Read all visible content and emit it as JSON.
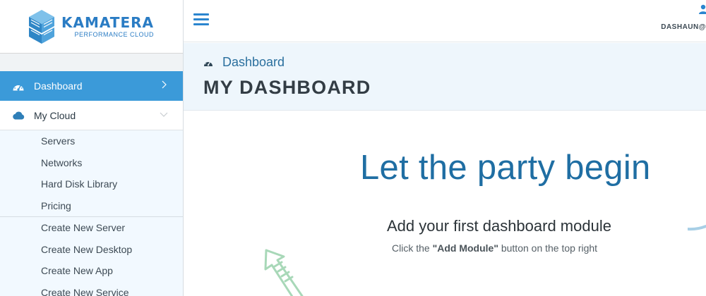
{
  "brand": {
    "name": "KAMATERA",
    "tagline": "PERFORMANCE CLOUD",
    "primary_color": "#2a7cc4"
  },
  "sidebar": {
    "items": [
      {
        "label": "Dashboard",
        "icon": "gauge-icon",
        "active": true
      },
      {
        "label": "My Cloud",
        "icon": "cloud-icon",
        "active": false
      }
    ],
    "cloud_links": [
      "Servers",
      "Networks",
      "Hard Disk Library",
      "Pricing"
    ],
    "create_links": [
      "Create New Server",
      "Create New Desktop",
      "Create New App",
      "Create New Service"
    ]
  },
  "topbar": {
    "menu_icon": "hamburger-icon",
    "user_icon": "user-icon",
    "username": "DASHAUN@"
  },
  "header": {
    "breadcrumb": "Dashboard",
    "title": "MY DASHBOARD"
  },
  "main": {
    "hero": "Let the party begin",
    "subtitle": "Add your first dashboard module",
    "hint_prefix": "Click the ",
    "hint_button": "\"Add Module\"",
    "hint_suffix": " button on the top right"
  },
  "colors": {
    "active_nav": "#3b9ad9",
    "header_band": "#eef6fc",
    "submenu_bg": "#f2f9ff",
    "hero_text": "#1f6ea3",
    "decor_green": "#a8d8b8"
  }
}
